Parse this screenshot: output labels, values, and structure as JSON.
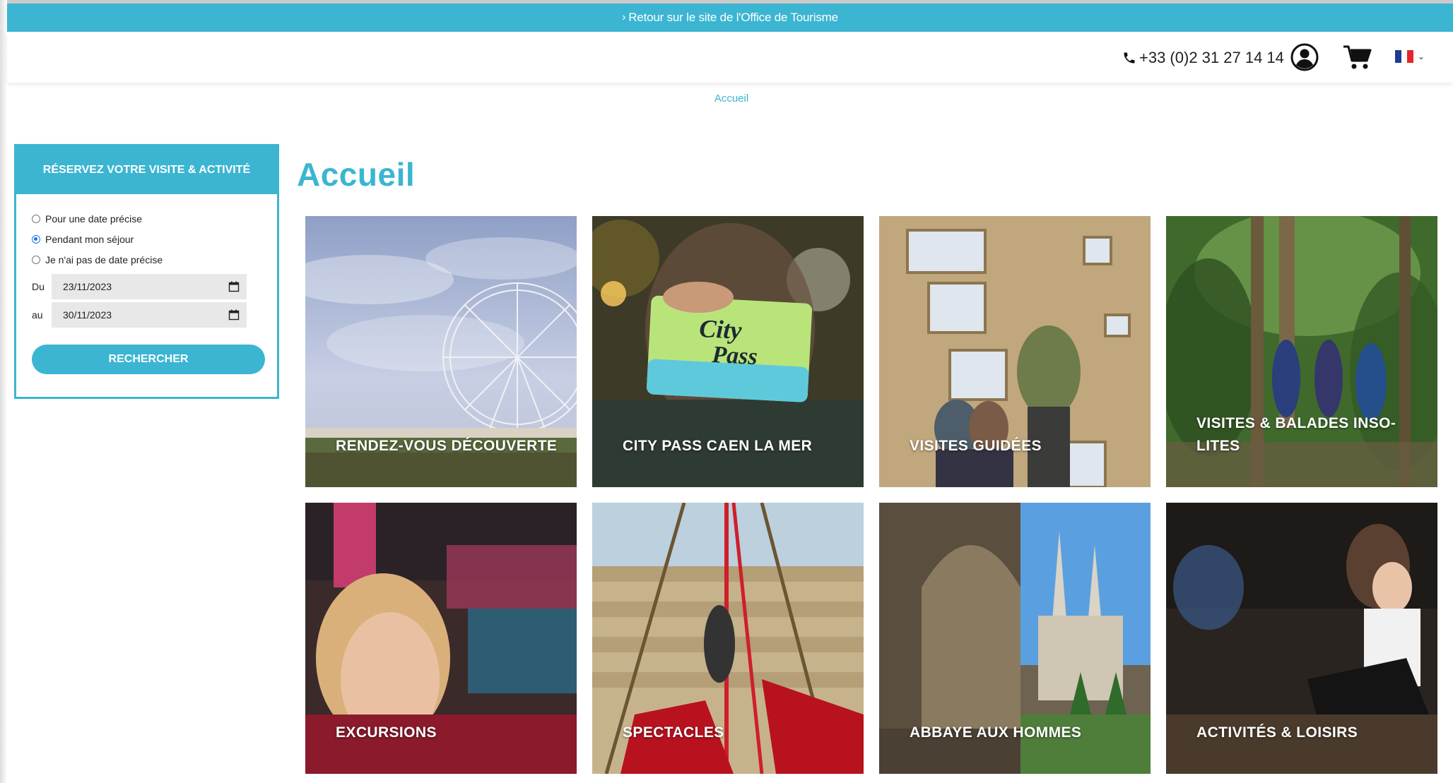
{
  "banner": {
    "text": "Retour sur le site de l'Office de Tourisme",
    "chevron": "›"
  },
  "header": {
    "phone": "+33 (0)2 31 27 14 14",
    "phone_icon": "phone-icon",
    "account_icon": "user-circle-icon",
    "cart_icon": "cart-icon",
    "language": {
      "flag": "fr-flag-icon",
      "colors": [
        "#1f3a93",
        "#ffffff",
        "#e4262c"
      ],
      "chevron": "⌄"
    }
  },
  "breadcrumb": "Accueil",
  "booking": {
    "title": "RÉSERVEZ VOTRE VISITE & ACTIVITÉ",
    "options": [
      {
        "label": "Pour une date précise",
        "checked": false
      },
      {
        "label": "Pendant mon séjour",
        "checked": true
      },
      {
        "label": "Je n'ai pas de date précise",
        "checked": false
      }
    ],
    "from_label": "Du",
    "from_value": "23/11/2023",
    "to_label": "au",
    "to_value": "30/11/2023",
    "search_label": "RECHERCHER"
  },
  "page_title": "Accueil",
  "tiles": [
    {
      "label": "RENDEZ-VOUS DÉCOUVERTE"
    },
    {
      "label": "CITY PASS CAEN LA MER",
      "card_text_1": "City",
      "card_text_2": "Pass"
    },
    {
      "label": "VISITES GUIDÉES"
    },
    {
      "label": "VISITES & BALADES INSO-LITES"
    },
    {
      "label": "EXCURSIONS"
    },
    {
      "label": "SPECTACLES"
    },
    {
      "label": "ABBAYE AUX HOMMES"
    },
    {
      "label": "ACTIVITÉS & LOISIRS"
    }
  ],
  "colors": {
    "accent": "#3bb5d1"
  }
}
